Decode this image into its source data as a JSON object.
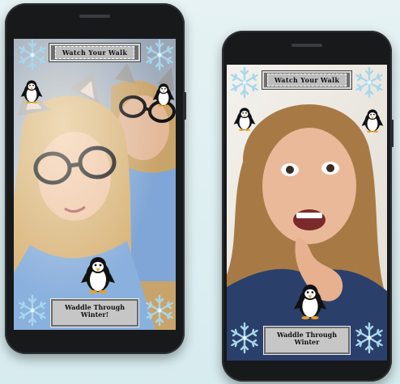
{
  "left_phone": {
    "top_banner": "Watch Your Walk",
    "bottom_banner_line1": "Waddle Through",
    "bottom_banner_line2": "Winter!"
  },
  "right_phone": {
    "top_banner": "Watch Your Walk",
    "bottom_banner_line1": "Waddle Through",
    "bottom_banner_line2": "Winter"
  },
  "icons": {
    "snowflake": "snowflake-icon",
    "penguin": "penguin-icon"
  },
  "colors": {
    "background": "#dcedf0",
    "phone_body": "#17191b",
    "banner_fill": "#bdbdbd",
    "snowflake": "#a9d6ea"
  }
}
